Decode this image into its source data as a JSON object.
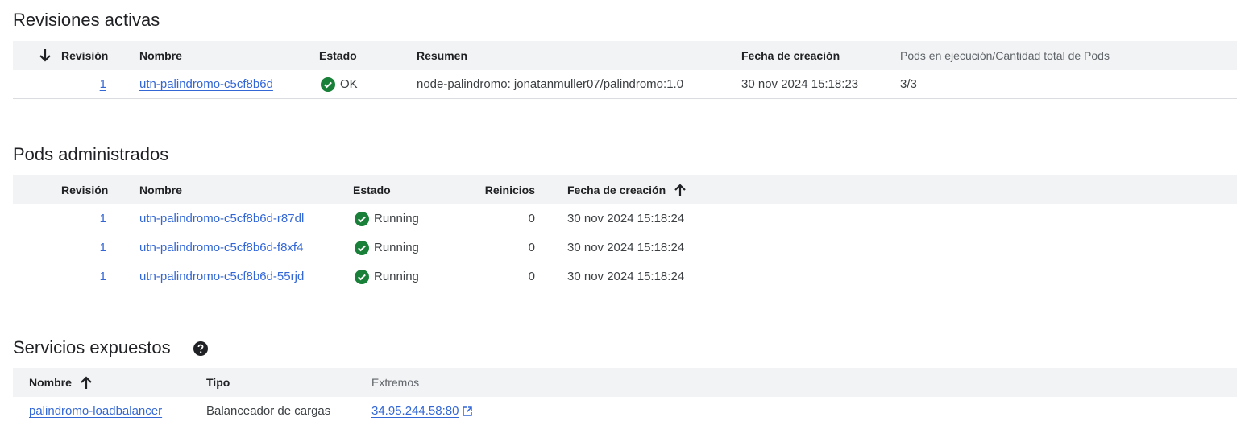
{
  "revisions": {
    "title": "Revisiones activas",
    "headers": {
      "revision": "Revisión",
      "name": "Nombre",
      "status": "Estado",
      "summary": "Resumen",
      "created": "Fecha de creación",
      "pods": "Pods en ejecución/Cantidad total de Pods"
    },
    "rows": [
      {
        "revision": "1",
        "name": "utn-palindromo-c5cf8b6d",
        "status": "OK",
        "summary": "node-palindromo: jonatanmuller07/palindromo:1.0",
        "created": "30 nov 2024 15:18:23",
        "pods": "3/3"
      }
    ]
  },
  "pods": {
    "title": "Pods administrados",
    "headers": {
      "revision": "Revisión",
      "name": "Nombre",
      "status": "Estado",
      "restarts": "Reinicios",
      "created": "Fecha de creación"
    },
    "rows": [
      {
        "revision": "1",
        "name": "utn-palindromo-c5cf8b6d-r87dl",
        "status": "Running",
        "restarts": "0",
        "created": "30 nov 2024 15:18:24"
      },
      {
        "revision": "1",
        "name": "utn-palindromo-c5cf8b6d-f8xf4",
        "status": "Running",
        "restarts": "0",
        "created": "30 nov 2024 15:18:24"
      },
      {
        "revision": "1",
        "name": "utn-palindromo-c5cf8b6d-55rjd",
        "status": "Running",
        "restarts": "0",
        "created": "30 nov 2024 15:18:24"
      }
    ]
  },
  "services": {
    "title": "Servicios expuestos",
    "headers": {
      "name": "Nombre",
      "type": "Tipo",
      "endpoints": "Extremos"
    },
    "rows": [
      {
        "name": "palindromo-loadbalancer",
        "type": "Balanceador de cargas",
        "endpoint": "34.95.244.58:80"
      }
    ]
  },
  "icons": {
    "sort_down": "arrow-down-icon",
    "sort_up": "arrow-up-icon",
    "status_ok": "check-circle-icon",
    "help": "help-circle-icon",
    "external": "open-in-new-icon"
  },
  "colors": {
    "link": "#3367d6",
    "ok_green": "#188038",
    "header_bg": "#f1f3f4",
    "divider": "#dadce0"
  }
}
